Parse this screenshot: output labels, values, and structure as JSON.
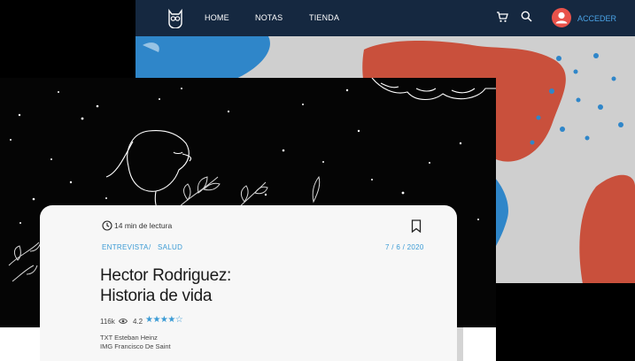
{
  "header": {
    "nav": [
      "HOME",
      "NOTAS",
      "TIENDA"
    ],
    "login_label": "ACCEDER",
    "icons": [
      "owl-logo-icon",
      "cart-icon",
      "search-icon",
      "user-icon"
    ]
  },
  "article": {
    "read_time": "14 min de lectura",
    "category": "ENTREVISTA",
    "separator": "/",
    "subcategory": "SALUD",
    "date": "7 / 6 / 2020",
    "title_line1": "Hector Rodriguez:",
    "title_line2": "Historia de vida",
    "views": "116k",
    "rating_value": "4.2",
    "stars": "★★★★☆",
    "credit_text": "TXT Esteban Heinz",
    "credit_image": "IMG Francisco De Saint"
  },
  "colors": {
    "nav_bg": "#152840",
    "accent": "#3b9bd5",
    "avatar": "#e8524a",
    "blob_blue": "#2f86c9",
    "blob_red": "#c9503c"
  }
}
